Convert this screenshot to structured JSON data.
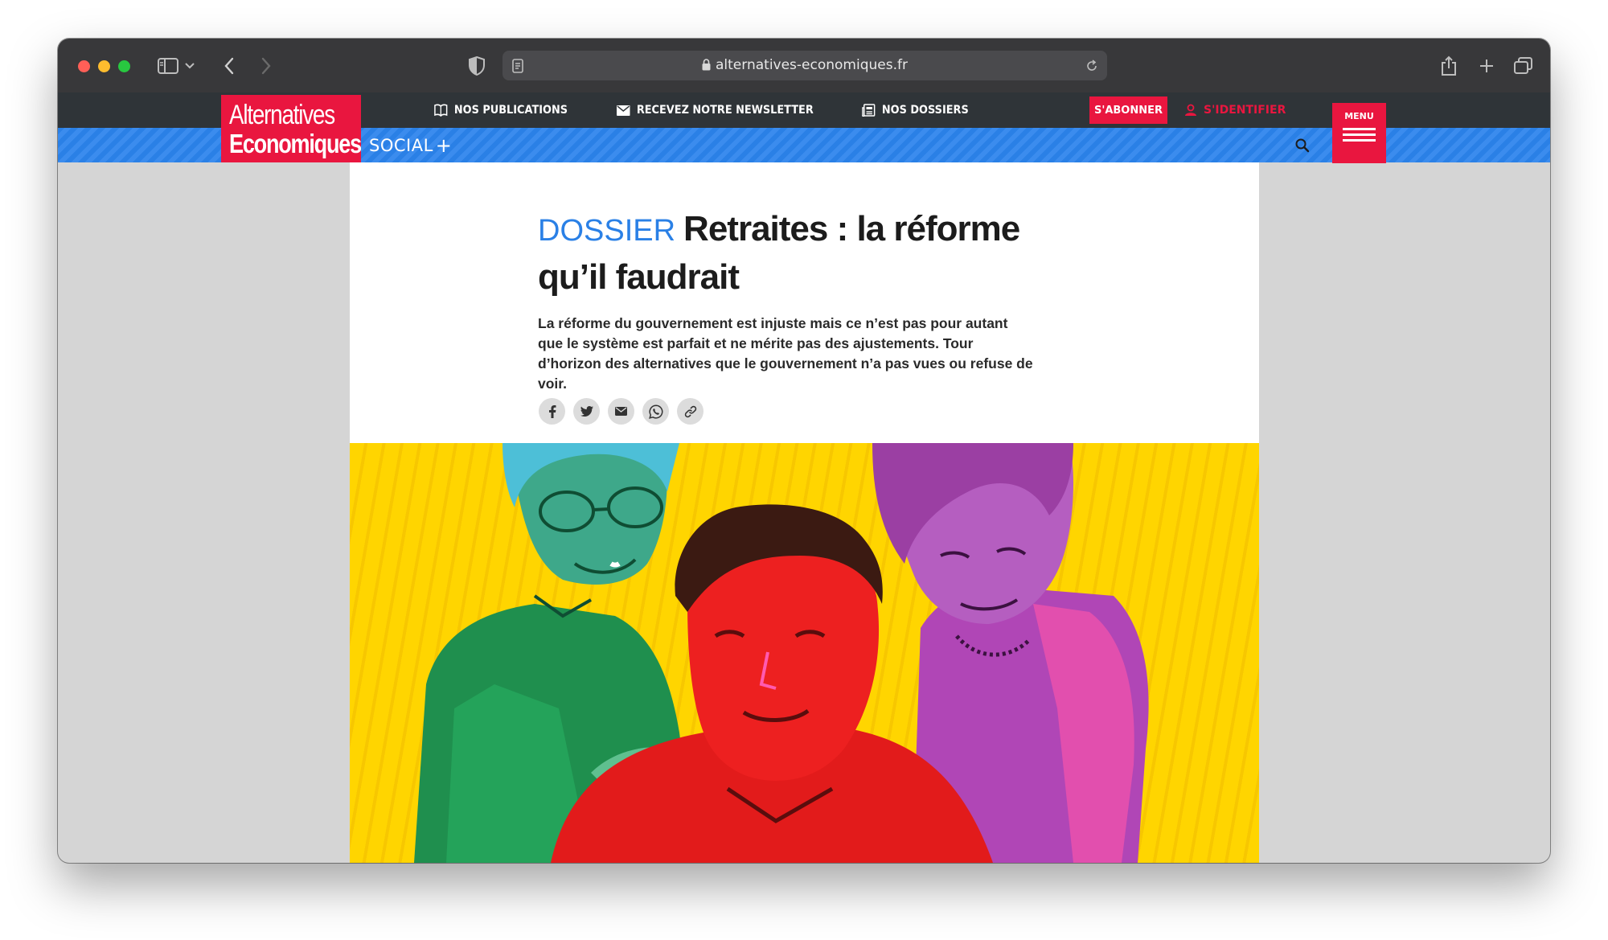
{
  "browser": {
    "url": "alternatives-economiques.fr",
    "icons": [
      "sidebar-icon",
      "chevron-down-icon",
      "back-icon",
      "forward-icon",
      "shield-icon",
      "reader-icon",
      "lock-icon",
      "reload-icon",
      "share-icon",
      "new-tab-icon",
      "tabs-icon"
    ]
  },
  "site": {
    "logo_line1": "Alternatives",
    "logo_line2": "Economiques",
    "nav": {
      "publications": "NOS PUBLICATIONS",
      "newsletter": "RECEVEZ NOTRE NEWSLETTER",
      "dossiers": "NOS DOSSIERS"
    },
    "subscribe": "S'ABONNER",
    "login": "S'IDENTIFIER",
    "menu": "MENU",
    "section": "SOCIAL",
    "section_plus": "+",
    "colors": {
      "brand_red": "#e9163f",
      "blue": "#2a80e6",
      "nav_bg": "#2f3438"
    }
  },
  "article": {
    "kicker": "DOSSIER",
    "title": "Retraites : la réforme qu’il faudrait",
    "chapo": "La réforme du gouvernement est injuste mais ce n’est pas pour autant que le système est parfait et ne mérite pas des ajustements. Tour d’horizon des alternatives que le gouvernement n’a pas vues ou refuse de voir.",
    "share_icons": [
      "facebook-icon",
      "twitter-icon",
      "email-icon",
      "whatsapp-icon",
      "link-icon"
    ]
  }
}
